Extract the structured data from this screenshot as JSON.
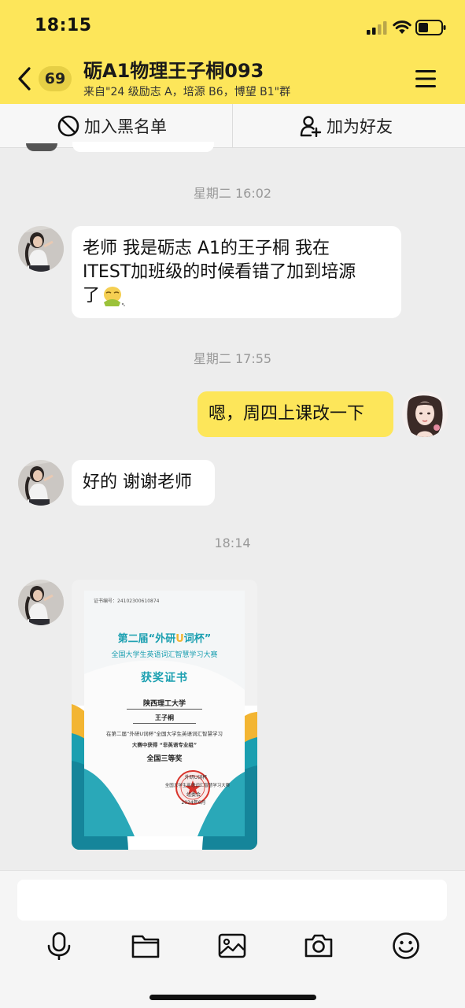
{
  "status_bar": {
    "time": "18:15"
  },
  "header": {
    "unread_count": "69",
    "title": "砺A1物理王子桐093",
    "subtitle": "来自\"24 级励志 A，培源 B6，博望 B1\"群",
    "background_color": "#fde65a"
  },
  "actions": {
    "blacklist_label": "加入黑名单",
    "blacklist_icon": "block-icon",
    "add_friend_label": "加为好友",
    "add_friend_icon": "add-user-icon"
  },
  "messages": [
    {
      "type": "timestamp",
      "text": "星期二 16:02"
    },
    {
      "type": "text",
      "sender": "other",
      "lines": [
        "老师 我是砺志 A1的王子桐 我在",
        "ITEST加班级的时候看错了加到培源",
        "了"
      ]
    },
    {
      "type": "timestamp",
      "text": "星期二 17:55"
    },
    {
      "type": "text",
      "sender": "self",
      "text": "嗯，周四上课改一下"
    },
    {
      "type": "text",
      "sender": "other",
      "text": "好的 谢谢老师"
    },
    {
      "type": "timestamp",
      "text": "18:14"
    },
    {
      "type": "image",
      "sender": "other",
      "certificate": {
        "number_label": "证书编号：",
        "number": "24102300610874",
        "edition": "第二届",
        "cup_name_before": "“外研",
        "cup_name_letter": "U",
        "cup_name_after": "词杯”",
        "competition": "全国大学生英语词汇智慧学习大赛",
        "heading": "获奖证书",
        "school": "陕西理工大学",
        "winner": "王子桐",
        "body_line1": "在第二届“外研U词杯”全国大学生英语词汇智慧学习",
        "body_line2": "大赛中获得 “非英语专业组”",
        "award": "全国三等奖",
        "issuer_line1": "外研U词杯",
        "issuer_line2": "全国大学生英语词汇智慧学习大赛",
        "issuer_line3": "组委会",
        "issue_date": "2024年6月",
        "accent_teal": "#1a9fb0",
        "accent_yellow": "#f3b532"
      }
    }
  ],
  "input": {
    "placeholder": ""
  },
  "toolbar": [
    "microphone-icon",
    "folder-icon",
    "image-icon",
    "camera-icon",
    "emoji-icon"
  ]
}
